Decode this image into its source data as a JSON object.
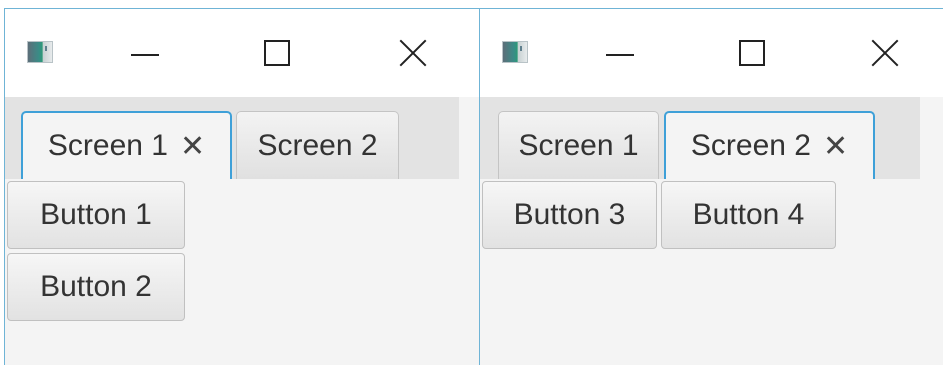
{
  "windows": [
    {
      "tabs": [
        {
          "label": "Screen 1",
          "close": "✕",
          "active": true
        },
        {
          "label": "Screen 2",
          "active": false
        }
      ],
      "buttons": [
        "Button 1",
        "Button 2"
      ]
    },
    {
      "tabs": [
        {
          "label": "Screen 1",
          "active": false
        },
        {
          "label": "Screen 2",
          "close": "✕",
          "active": true
        }
      ],
      "buttons": [
        "Button 3",
        "Button 4"
      ]
    }
  ],
  "icons": {
    "app": "app-icon",
    "minimize": "minimize-icon",
    "maximize": "maximize-icon",
    "close": "close-icon"
  },
  "colors": {
    "active_tab_border": "#3ea0d8",
    "window_border": "#6fb4d6",
    "tab_bar": "#e3e3e3",
    "content_bg": "#f4f4f4"
  }
}
